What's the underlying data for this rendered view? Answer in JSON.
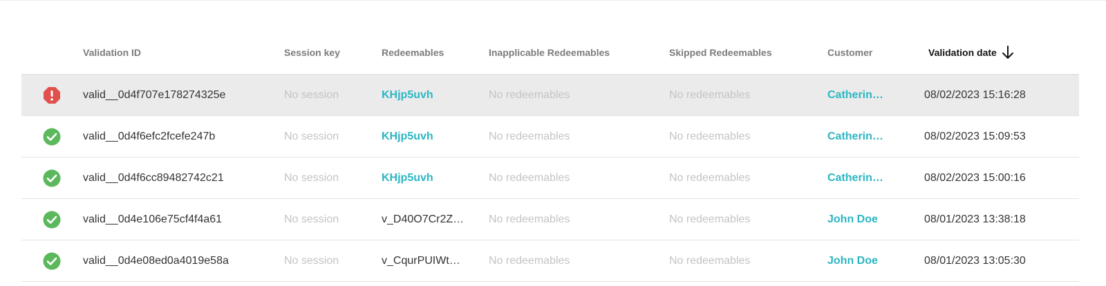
{
  "colors": {
    "link": "#2bb6c3",
    "success": "#5cb85c",
    "error": "#e0504d",
    "muted_text": "#c4c4c4",
    "selected_row": "#ebebeb"
  },
  "table": {
    "columns": {
      "validation_id": "Validation ID",
      "session_key": "Session key",
      "redeemables": "Redeemables",
      "inapplicable": "Inapplicable Redeemables",
      "skipped": "Skipped Redeemables",
      "customer": "Customer",
      "validation_date": "Validation date"
    },
    "sort": {
      "column": "validation_date",
      "direction": "descending",
      "icon": "arrow-down-icon"
    },
    "rows": [
      {
        "status": "error",
        "status_icon": "error-octagon-icon",
        "id": "valid__0d4f707e178274325e",
        "session": "No session",
        "redeemables": "KHjp5uvh",
        "redeemables_link": true,
        "inapplicable": "No redeemables",
        "skipped": "No redeemables",
        "customer": "Catherin…",
        "date": "08/02/2023 15:16:28",
        "selected": true
      },
      {
        "status": "success",
        "status_icon": "check-circle-icon",
        "id": "valid__0d4f6efc2fcefe247b",
        "session": "No session",
        "redeemables": "KHjp5uvh",
        "redeemables_link": true,
        "inapplicable": "No redeemables",
        "skipped": "No redeemables",
        "customer": "Catherin…",
        "date": "08/02/2023 15:09:53",
        "selected": false
      },
      {
        "status": "success",
        "status_icon": "check-circle-icon",
        "id": "valid__0d4f6cc89482742c21",
        "session": "No session",
        "redeemables": "KHjp5uvh",
        "redeemables_link": true,
        "inapplicable": "No redeemables",
        "skipped": "No redeemables",
        "customer": "Catherin…",
        "date": "08/02/2023 15:00:16",
        "selected": false
      },
      {
        "status": "success",
        "status_icon": "check-circle-icon",
        "id": "valid__0d4e106e75cf4f4a61",
        "session": "No session",
        "redeemables": "v_D40O7Cr2Z…",
        "redeemables_link": false,
        "inapplicable": "No redeemables",
        "skipped": "No redeemables",
        "customer": "John Doe",
        "date": "08/01/2023 13:38:18",
        "selected": false
      },
      {
        "status": "success",
        "status_icon": "check-circle-icon",
        "id": "valid__0d4e08ed0a4019e58a",
        "session": "No session",
        "redeemables": "v_CqurPUIWt…",
        "redeemables_link": false,
        "inapplicable": "No redeemables",
        "skipped": "No redeemables",
        "customer": "John Doe",
        "date": "08/01/2023 13:05:30",
        "selected": false
      }
    ]
  }
}
